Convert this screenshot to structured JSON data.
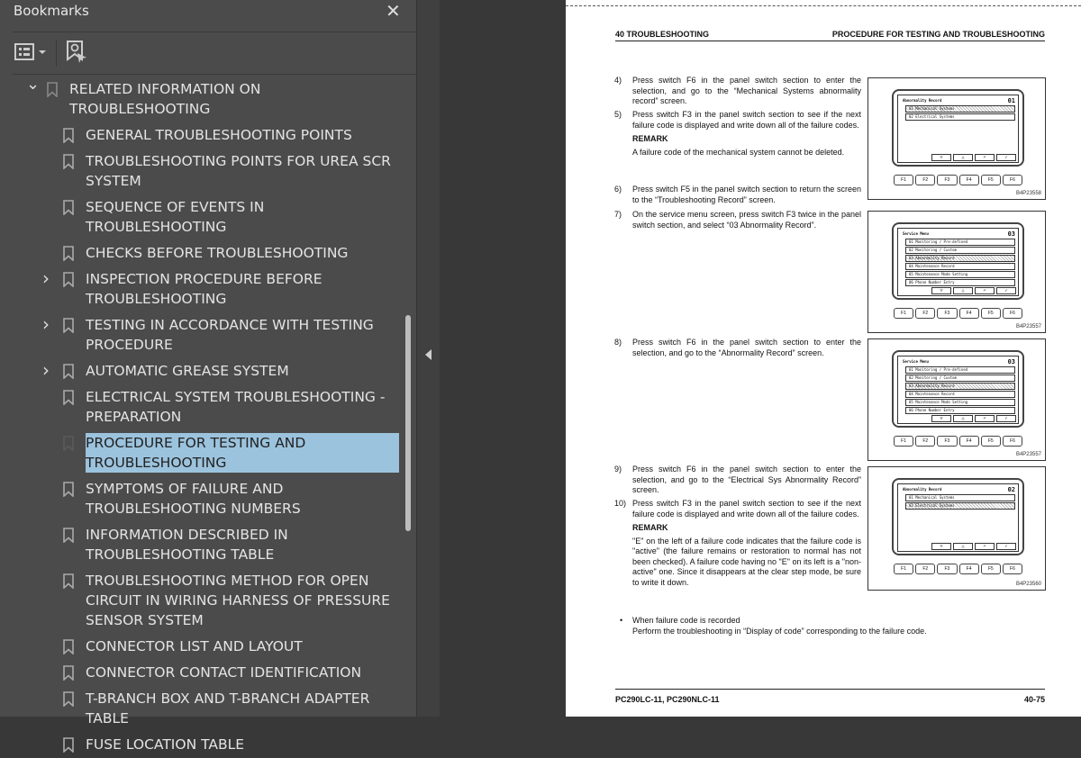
{
  "panel": {
    "title": "Bookmarks",
    "close_icon": "close-icon",
    "options_icon": "bookmark-options-icon",
    "find_icon": "find-current-bookmark-icon"
  },
  "bookmarks": [
    {
      "label": "RELATED INFORMATION ON TROUBLESHOOTING",
      "level": 0,
      "expander": "expanded"
    },
    {
      "label": "GENERAL TROUBLESHOOTING POINTS",
      "level": 1
    },
    {
      "label": "TROUBLESHOOTING POINTS FOR UREA SCR SYSTEM",
      "level": 1
    },
    {
      "label": "SEQUENCE OF EVENTS IN TROUBLESHOOTING",
      "level": 1
    },
    {
      "label": "CHECKS BEFORE TROUBLESHOOTING",
      "level": 1
    },
    {
      "label": "INSPECTION PROCEDURE BEFORE TROUBLESHOOTING",
      "level": 1,
      "expander": "collapsed"
    },
    {
      "label": "TESTING IN ACCORDANCE WITH TESTING PROCEDURE",
      "level": 1,
      "expander": "collapsed"
    },
    {
      "label": "AUTOMATIC GREASE SYSTEM",
      "level": 1,
      "expander": "collapsed"
    },
    {
      "label": "ELECTRICAL SYSTEM TROUBLESHOOTING - PREPARATION",
      "level": 1
    },
    {
      "label": "PROCEDURE FOR TESTING AND TROUBLESHOOTING",
      "level": 1,
      "selected": true
    },
    {
      "label": "SYMPTOMS OF FAILURE AND TROUBLESHOOTING NUMBERS",
      "level": 1
    },
    {
      "label": "INFORMATION DESCRIBED IN TROUBLESHOOTING TABLE",
      "level": 1
    },
    {
      "label": "TROUBLESHOOTING METHOD FOR OPEN CIRCUIT IN WIRING HARNESS OF PRESSURE SENSOR SYSTEM",
      "level": 1
    },
    {
      "label": "CONNECTOR LIST AND LAYOUT",
      "level": 1
    },
    {
      "label": "CONNECTOR CONTACT IDENTIFICATION",
      "level": 1
    },
    {
      "label": "T-BRANCH BOX AND T-BRANCH ADAPTER TABLE",
      "level": 1
    },
    {
      "label": "FUSE LOCATION TABLE",
      "level": 1
    }
  ],
  "colors": {
    "selected_bg": "#9cc3dd",
    "panel_bg": "#4b4b4b"
  },
  "page": {
    "header_left": "40 TROUBLESHOOTING",
    "header_right": "PROCEDURE FOR TESTING AND TROUBLESHOOTING",
    "footer_left": "PC290LC-11, PC290NLC-11",
    "footer_right": "40-75",
    "steps": [
      {
        "n": "4)",
        "text": "Press switch F6 in the panel switch section to enter the selection, and go to the “Mechanical Systems abnormality record” screen."
      },
      {
        "n": "5)",
        "text": "Press switch F3 in the panel switch section to see if the next failure code is displayed and write down all of the failure codes.",
        "remark": "REMARK",
        "remark_text": "A failure code of the mechanical system cannot be deleted."
      },
      {
        "n": "6)",
        "text": "Press switch F5 in the panel switch section to return the screen to the “Troubleshooting Record” screen."
      },
      {
        "n": "7)",
        "text": "On the service menu screen, press switch F3 twice in the panel switch section, and select “03 Abnormality Record”."
      },
      {
        "n": "8)",
        "text": "Press switch F6 in the panel switch section to enter the selection, and go to the “Abnormality Record” screen."
      },
      {
        "n": "9)",
        "text": "Press switch F6 in the panel switch section to enter the selection, and go to the “Electrical Sys Abnormality Record” screen."
      },
      {
        "n": "10)",
        "text": "Press switch F3 in the panel switch section to see if the next failure code is displayed and write down all of the failure codes.",
        "remark": "REMARK",
        "remark_text": "\"E\" on the left of a failure code indicates that the failure code is \"active\" (the failure remains or restoration to normal has not been checked). A failure code having no \"E\" on its left is a \"non-active\" one. Since it disappears at the clear step mode, be sure to write it down."
      },
      {
        "n": "•",
        "text": "When failure code is recorded",
        "text2": "Perform the troubleshooting in “Display of code” corresponding to the failure code."
      }
    ],
    "figures": [
      {
        "screen_title": "Abnormality Record",
        "number": "01",
        "items": [
          "01 Mechanical Systems",
          "02 Electrical Systems"
        ],
        "highlight": 0,
        "caption": "B4P23558"
      },
      {
        "screen_title": "Service Menu",
        "number": "03",
        "items": [
          "01 Monitoring / Pre-defined",
          "02 Monitoring / Custom",
          "03 Abnormality Record",
          "04 Maintenance Record",
          "05 Maintenance Mode Setting",
          "06 Phone Number Entry"
        ],
        "highlight": 2,
        "caption": "B4P23557"
      },
      {
        "screen_title": "Service Menu",
        "number": "03",
        "items": [
          "01 Monitoring / Pre-defined",
          "02 Monitoring / Custom",
          "03 Abnormality Record",
          "04 Maintenance Record",
          "05 Maintenance Mode Setting",
          "06 Phone Number Entry"
        ],
        "highlight": 2,
        "caption": "B4P23557"
      },
      {
        "screen_title": "Abnormality Record",
        "number": "02",
        "items": [
          "01 Mechanical Systems",
          "02 Electrical Systems"
        ],
        "highlight": 1,
        "caption": "B4P23560"
      }
    ],
    "keys": [
      "F1",
      "F2",
      "F3",
      "F4",
      "F5",
      "F6"
    ],
    "soft_keys": [
      "▽",
      "△",
      "↶",
      "✓"
    ]
  }
}
